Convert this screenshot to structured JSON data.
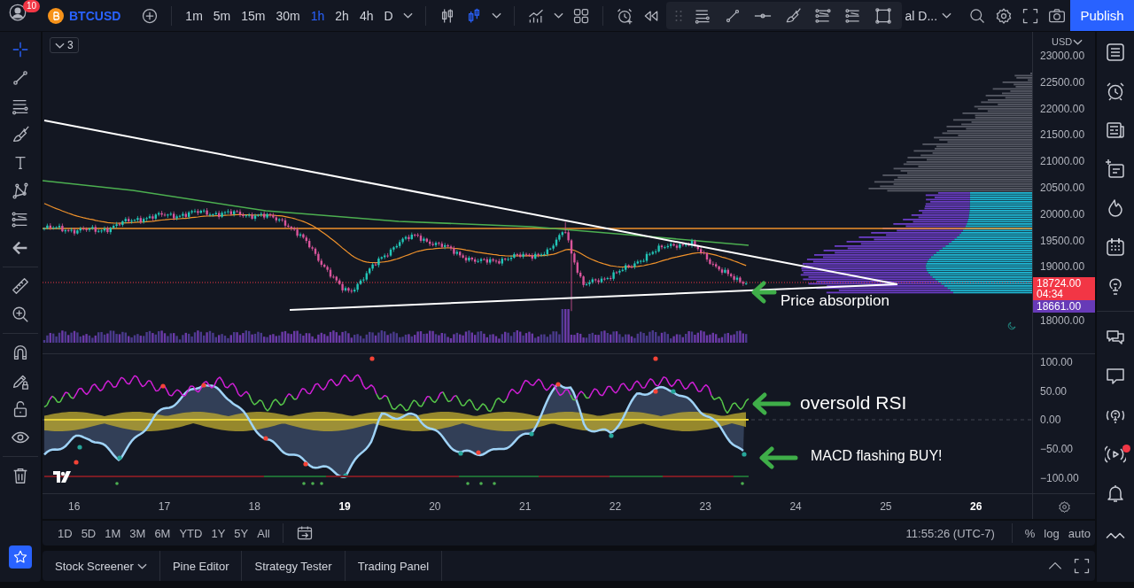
{
  "top_bar": {
    "notification_count": "10",
    "symbol": "BTCUSD",
    "intervals": [
      {
        "label": "1m",
        "selected": false
      },
      {
        "label": "5m",
        "selected": false
      },
      {
        "label": "15m",
        "selected": false
      },
      {
        "label": "30m",
        "selected": false
      },
      {
        "label": "1h",
        "selected": true
      },
      {
        "label": "2h",
        "selected": false
      },
      {
        "label": "4h",
        "selected": false
      },
      {
        "label": "D",
        "selected": false
      }
    ],
    "chart_types": [
      {
        "kind": "bars",
        "selected": false
      },
      {
        "kind": "candles",
        "selected": true
      }
    ],
    "layout_name": "al D...",
    "publish": "Publish"
  },
  "left_toolbar": {
    "groups": [
      [
        {
          "kind": "crosshair",
          "selected": true
        },
        {
          "kind": "trend",
          "selected": false
        },
        {
          "kind": "hlines",
          "selected": false
        },
        {
          "kind": "brush",
          "selected": false
        },
        {
          "kind": "text",
          "selected": false
        },
        {
          "kind": "pattern",
          "selected": false
        },
        {
          "kind": "fib",
          "selected": false
        },
        {
          "kind": "back",
          "selected": false
        }
      ],
      [
        {
          "kind": "ruler",
          "selected": false
        },
        {
          "kind": "zoom",
          "selected": false
        }
      ],
      [
        {
          "kind": "magnet",
          "selected": false
        },
        {
          "kind": "pencillock",
          "selected": false
        },
        {
          "kind": "lock",
          "selected": false
        },
        {
          "kind": "eye",
          "selected": false
        }
      ],
      [
        {
          "kind": "trash",
          "selected": false
        }
      ]
    ]
  },
  "chart": {
    "legend_count": "3",
    "price_annotations": [
      "Price absorption"
    ],
    "indicator_annotations": [
      "oversold RSI",
      "MACD flashing BUY!"
    ],
    "price_axis": {
      "currency": "USD",
      "labels_upper": [
        "23000.00",
        "22500.00",
        "22000.00",
        "21500.00",
        "21000.00",
        "20500.00",
        "20000.00",
        "19500.00",
        "19000.00"
      ],
      "tags": [
        {
          "price": "18724.00",
          "countdown": "04:34",
          "color": "#f23645"
        },
        {
          "price": "18661.00",
          "color": "#673ab7"
        }
      ],
      "labels_lower": [
        "18000.00"
      ]
    },
    "indicator_axis": [
      "100.00",
      "50.00",
      "0.00",
      "−50.00",
      "−100.00"
    ],
    "time_axis": [
      {
        "label": "16",
        "bold": false
      },
      {
        "label": "17",
        "bold": false
      },
      {
        "label": "18",
        "bold": false
      },
      {
        "label": "19",
        "bold": true
      },
      {
        "label": "20",
        "bold": false
      },
      {
        "label": "21",
        "bold": false
      },
      {
        "label": "22",
        "bold": false
      },
      {
        "label": "23",
        "bold": false
      },
      {
        "label": "24",
        "bold": false
      },
      {
        "label": "25",
        "bold": false
      },
      {
        "label": "26",
        "bold": true
      }
    ]
  },
  "range_bar": {
    "ranges": [
      "1D",
      "5D",
      "1M",
      "3M",
      "6M",
      "YTD",
      "1Y",
      "5Y",
      "All"
    ],
    "clock": "11:55:26 (UTC-7)",
    "options": [
      "%",
      "log",
      "auto"
    ]
  },
  "bottom_panel": {
    "tabs": [
      {
        "label": "Stock Screener",
        "menu": true
      },
      {
        "label": "Pine Editor",
        "menu": false
      },
      {
        "label": "Strategy Tester",
        "menu": false
      },
      {
        "label": "Trading Panel",
        "menu": false
      }
    ]
  },
  "right_sidebar": {
    "groups": [
      [
        {
          "kind": "list",
          "badge": false
        },
        {
          "kind": "alarm",
          "badge": false
        },
        {
          "kind": "news",
          "badge": false
        },
        {
          "kind": "listplus",
          "badge": false
        },
        {
          "kind": "fire",
          "badge": false
        },
        {
          "kind": "calendar",
          "badge": false
        },
        {
          "kind": "bulb",
          "badge": false
        }
      ],
      [
        {
          "kind": "chats",
          "badge": false
        },
        {
          "kind": "chat",
          "badge": false
        },
        {
          "kind": "bulbsignal",
          "badge": false
        },
        {
          "kind": "stream",
          "badge": true
        },
        {
          "kind": "bell",
          "badge": false
        }
      ]
    ]
  }
}
